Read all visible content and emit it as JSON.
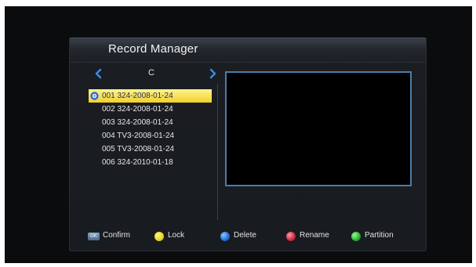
{
  "dialog": {
    "title": "Record Manager"
  },
  "drive": {
    "label": "C",
    "prev_icon": "chevron-left-icon",
    "next_icon": "chevron-right-icon"
  },
  "records": [
    {
      "label": "001 324-2008-01-24",
      "selected": true,
      "icon": "record-lock-icon"
    },
    {
      "label": "002 324-2008-01-24",
      "selected": false
    },
    {
      "label": "003 324-2008-01-24",
      "selected": false
    },
    {
      "label": "004 TV3-2008-01-24",
      "selected": false
    },
    {
      "label": "005 TV3-2008-01-24",
      "selected": false
    },
    {
      "label": "006 324-2010-01-18",
      "selected": false
    }
  ],
  "footer": {
    "confirm": {
      "key_text": "OK",
      "label": "Confirm",
      "icon": "ok-key-icon"
    },
    "lock": {
      "label": "Lock",
      "color": "#e8d21c",
      "icon": "yellow-key-icon"
    },
    "delete": {
      "label": "Delete",
      "color": "#1e6fd8",
      "icon": "blue-key-icon"
    },
    "rename": {
      "label": "Rename",
      "color": "#c8283a",
      "icon": "red-key-icon"
    },
    "partition": {
      "label": "Partition",
      "color": "#22b22a",
      "icon": "green-key-icon"
    }
  },
  "colors": {
    "highlight": "#f2d02a",
    "preview_border": "#4b7da8",
    "arrow": "#3a8de0"
  }
}
